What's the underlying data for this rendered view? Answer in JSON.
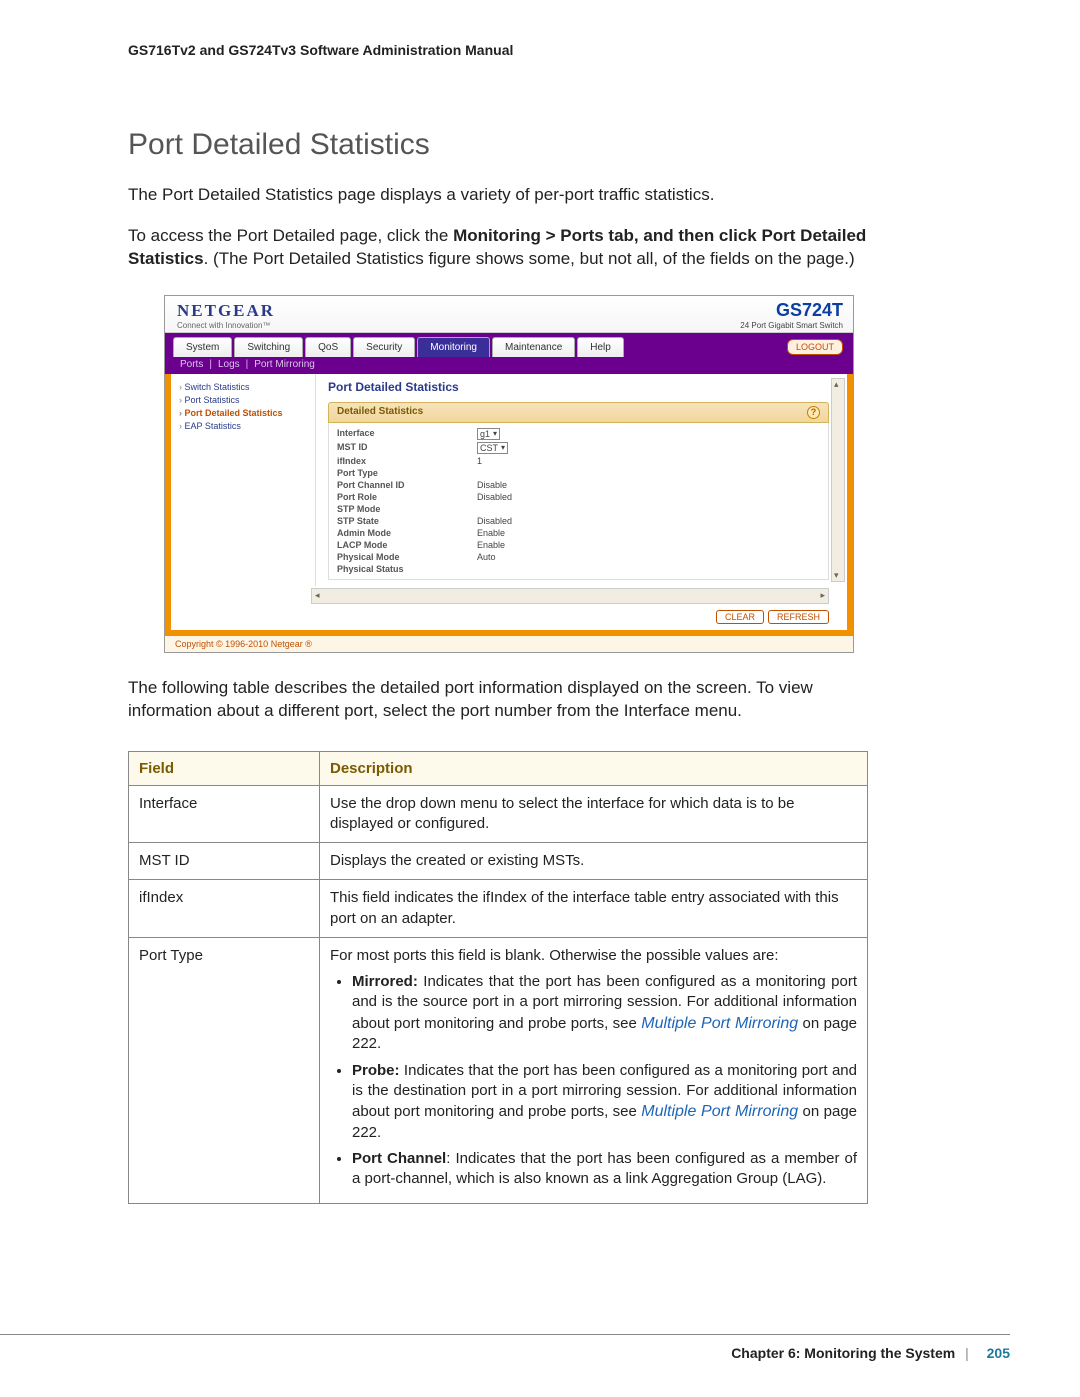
{
  "doc_header": "GS716Tv2 and GS724Tv3 Software Administration Manual",
  "section_title": "Port Detailed Statistics",
  "intro_para": "The Port Detailed Statistics page displays a variety of per-port traffic statistics.",
  "access_para_pre": "To access the Port Detailed page, click the ",
  "access_bold": "Monitoring > Ports tab, and then click Port Detailed Statistics",
  "access_para_post": ". (The Port Detailed Statistics figure shows some, but not all, of the fields on the page.)",
  "post_para": "The following table describes the detailed port information displayed on the screen. To view information about a different port, select the port number from the Interface menu.",
  "screenshot": {
    "logo": "NETGEAR",
    "tagline": "Connect with Innovation™",
    "model": "GS724T",
    "model_sub": "24 Port Gigabit Smart Switch",
    "tabs": [
      "System",
      "Switching",
      "QoS",
      "Security",
      "Monitoring",
      "Maintenance",
      "Help"
    ],
    "active_tab": "Monitoring",
    "logout": "LOGOUT",
    "subnav": [
      "Ports",
      "Logs",
      "Port Mirroring"
    ],
    "sidenav": [
      {
        "label": "Switch Statistics",
        "active": false
      },
      {
        "label": "Port Statistics",
        "active": false
      },
      {
        "label": "Port Detailed Statistics",
        "active": true
      },
      {
        "label": "EAP Statistics",
        "active": false
      }
    ],
    "panel_title": "Port Detailed Statistics",
    "sub_panel_title": "Detailed Statistics",
    "stats": [
      {
        "label": "Interface",
        "value": "g1",
        "select": true
      },
      {
        "label": "MST ID",
        "value": "CST",
        "select": true
      },
      {
        "label": "ifIndex",
        "value": "1"
      },
      {
        "label": "Port Type",
        "value": ""
      },
      {
        "label": "Port Channel ID",
        "value": "Disable"
      },
      {
        "label": "Port Role",
        "value": "Disabled"
      },
      {
        "label": "STP Mode",
        "value": ""
      },
      {
        "label": "STP State",
        "value": "Disabled"
      },
      {
        "label": "Admin Mode",
        "value": "Enable"
      },
      {
        "label": "LACP Mode",
        "value": "Enable"
      },
      {
        "label": "Physical Mode",
        "value": "Auto"
      },
      {
        "label": "Physical Status",
        "value": ""
      }
    ],
    "buttons": [
      "CLEAR",
      "REFRESH"
    ],
    "copyright": "Copyright © 1996-2010 Netgear ®"
  },
  "table": {
    "headers": [
      "Field",
      "Description"
    ],
    "rows": [
      {
        "field": "Interface",
        "desc": "Use the drop down menu to select the interface for which data is to be displayed or configured."
      },
      {
        "field": "MST ID",
        "desc": "Displays the created or existing MSTs."
      },
      {
        "field": "ifIndex",
        "desc": "This field indicates the ifIndex of the interface table entry associated with this port on an adapter."
      },
      {
        "field": "Port Type",
        "desc_intro": "For most ports this field is blank. Otherwise the possible values are:",
        "bullets": [
          {
            "bold": "Mirrored:",
            "text": " Indicates that the port has been configured as a monitoring port and is the source port in a port mirroring session. For additional information about port monitoring and probe ports, see ",
            "link": "Multiple Port Mirroring",
            "tail": " on page 222."
          },
          {
            "bold": "Probe:",
            "text": " Indicates that the port has been configured as a monitoring port and is the destination port in a port mirroring session. For additional information about port monitoring and probe ports, see ",
            "link": "Multiple Port Mirroring",
            "tail": " on page 222."
          },
          {
            "bold": "Port Channel",
            "text": ": Indicates that the port has been configured as a member of a port-channel, which is also known as a link Aggregation Group (LAG)."
          }
        ]
      }
    ]
  },
  "footer": {
    "chapter": "Chapter 6:  Monitoring the System",
    "page": "205"
  }
}
